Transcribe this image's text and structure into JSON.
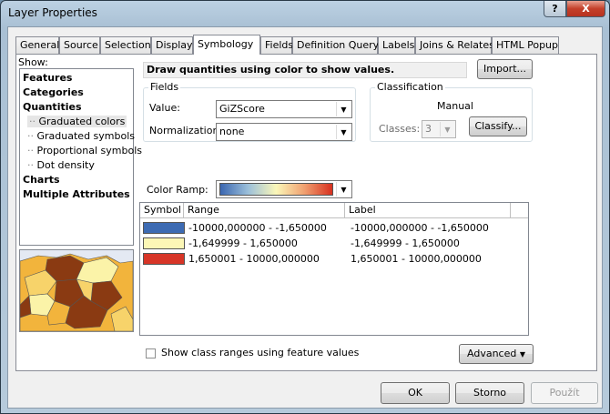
{
  "window": {
    "title": "Layer Properties",
    "help_label": "?",
    "close_label": "X"
  },
  "tabs": [
    {
      "label": "General"
    },
    {
      "label": "Source"
    },
    {
      "label": "Selection"
    },
    {
      "label": "Display"
    },
    {
      "label": "Symbology",
      "active": true
    },
    {
      "label": "Fields"
    },
    {
      "label": "Definition Query"
    },
    {
      "label": "Labels"
    },
    {
      "label": "Joins & Relates"
    },
    {
      "label": "HTML Popup"
    }
  ],
  "show": {
    "label": "Show:",
    "items": [
      {
        "label": "Features"
      },
      {
        "label": "Categories"
      },
      {
        "label": "Quantities"
      },
      {
        "label": "Graduated colors",
        "selected": true
      },
      {
        "label": "Graduated symbols"
      },
      {
        "label": "Proportional symbols"
      },
      {
        "label": "Dot density"
      },
      {
        "label": "Charts"
      },
      {
        "label": "Multiple Attributes"
      }
    ]
  },
  "description": "Draw quantities using color to show values.",
  "import_label": "Import...",
  "fields": {
    "group_label": "Fields",
    "value_label": "Value:",
    "value": "GiZScore",
    "normalization_label": "Normalization:",
    "normalization": "none"
  },
  "classification": {
    "group_label": "Classification",
    "method": "Manual",
    "classes_label": "Classes:",
    "classes": "3",
    "classify_label": "Classify..."
  },
  "color_ramp": {
    "label": "Color Ramp:",
    "colors": [
      "#3a66b0",
      "#9cc0da",
      "#fbf7b8",
      "#f0a070",
      "#d7301f"
    ]
  },
  "table": {
    "headers": {
      "symbol": "Symbol",
      "range": "Range",
      "label": "Label"
    },
    "rows": [
      {
        "color": "#3d6bb3",
        "range": "-10000,000000 - -1,650000",
        "label": "-10000,000000 - -1,650000"
      },
      {
        "color": "#fcf7b6",
        "range": "-1,649999 - 1,650000",
        "label": "-1,649999 - 1,650000"
      },
      {
        "color": "#d73527",
        "range": "1,650001 - 10000,000000",
        "label": "1,650001 - 10000,000000"
      }
    ]
  },
  "show_ranges_label": "Show class ranges using feature values",
  "advanced_label": "Advanced",
  "buttons": {
    "ok": "OK",
    "cancel": "Storno",
    "apply": "Použít"
  }
}
